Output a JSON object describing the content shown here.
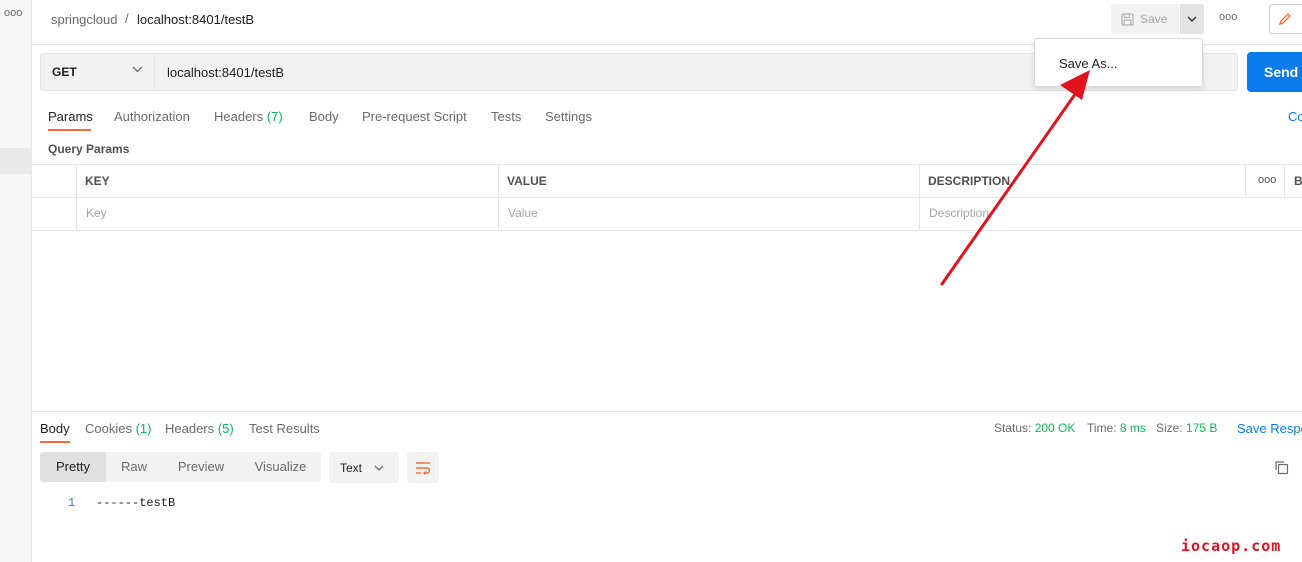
{
  "breadcrumb": {
    "collection": "springcloud",
    "separator": "/",
    "request": "localhost:8401/testB"
  },
  "toolbar": {
    "save_label": "Save",
    "more_label": "ooo"
  },
  "gutter": {
    "more_label": "ooo"
  },
  "dropdown": {
    "save_as_label": "Save As..."
  },
  "request": {
    "method": "GET",
    "url": "localhost:8401/testB",
    "send_label": "Send"
  },
  "tabs": [
    {
      "label": "Params",
      "count": ""
    },
    {
      "label": "Authorization",
      "count": ""
    },
    {
      "label": "Headers",
      "count": "(7)"
    },
    {
      "label": "Body",
      "count": ""
    },
    {
      "label": "Pre-request Script",
      "count": ""
    },
    {
      "label": "Tests",
      "count": ""
    },
    {
      "label": "Settings",
      "count": ""
    }
  ],
  "cookies_link": "Co",
  "query_params": {
    "title": "Query Params",
    "columns": [
      "KEY",
      "VALUE",
      "DESCRIPTION"
    ],
    "more_label": "ooo",
    "bulk_label": "B",
    "placeholders": [
      "Key",
      "Value",
      "Description"
    ]
  },
  "response": {
    "tabs": [
      {
        "label": "Body",
        "count": ""
      },
      {
        "label": "Cookies",
        "count": "(1)"
      },
      {
        "label": "Headers",
        "count": "(5)"
      },
      {
        "label": "Test Results",
        "count": ""
      }
    ],
    "status_label": "Status:",
    "status_value": "200 OK",
    "time_label": "Time:",
    "time_value": "8 ms",
    "size_label": "Size:",
    "size_value": "175 B",
    "save_label": "Save Respo",
    "views": [
      "Pretty",
      "Raw",
      "Preview",
      "Visualize"
    ],
    "format": "Text",
    "body": {
      "line": "1",
      "text": "------testB"
    }
  },
  "watermark": "iocaop.com",
  "colors": {
    "accent": "#097bed",
    "tab_underline": "#f26b3a",
    "success": "#0cbb52",
    "arrow": "#e0131f"
  }
}
